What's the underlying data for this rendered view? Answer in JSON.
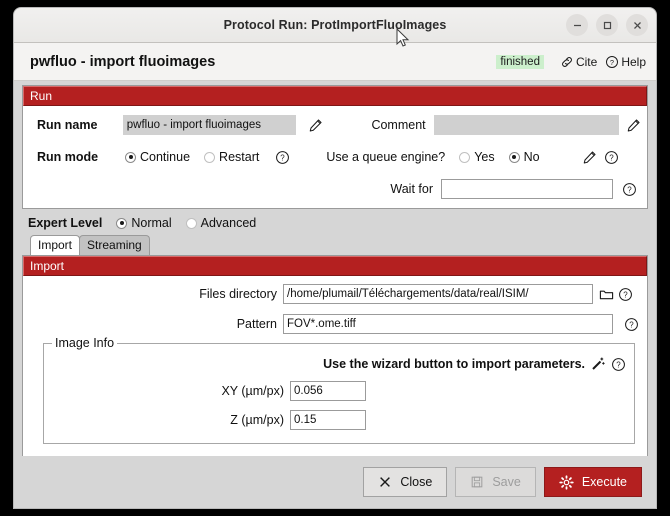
{
  "window": {
    "title": "Protocol Run: ProtImportFluoImages",
    "controls": {
      "minimize": "–",
      "maximize": "□",
      "close": "✕"
    }
  },
  "header": {
    "protocol_name": "pwfluo - import fluoimages",
    "status": "finished",
    "status_color": "#ccefcc",
    "cite_label": "Cite",
    "help_label": "Help"
  },
  "run_section": {
    "title": "Run",
    "run_name_label": "Run name",
    "run_name_value": "pwfluo - import fluoimages",
    "comment_label": "Comment",
    "comment_value": "",
    "run_mode_label": "Run mode",
    "run_mode_options": [
      "Continue",
      "Restart"
    ],
    "run_mode_selected": "Continue",
    "queue_label": "Use a queue engine?",
    "queue_options": [
      "Yes",
      "No"
    ],
    "queue_selected": "No",
    "wait_for_label": "Wait for",
    "wait_for_value": ""
  },
  "expert": {
    "label": "Expert Level",
    "options": [
      "Normal",
      "Advanced"
    ],
    "selected": "Normal"
  },
  "tabs": [
    {
      "label": "Import",
      "active": true
    },
    {
      "label": "Streaming",
      "active": false
    }
  ],
  "import_section": {
    "title": "Import",
    "files_directory_label": "Files directory",
    "files_directory_value": "/home/plumail/Téléchargements/data/real/ISIM/",
    "pattern_label": "Pattern",
    "pattern_value": "FOV*.ome.tiff"
  },
  "image_info": {
    "group_title": "Image Info",
    "wizard_text": "Use the wizard button to import parameters.",
    "xy_label": "XY (µm/px)",
    "xy_value": "0.056",
    "z_label": "Z (µm/px)",
    "z_value": "0.15"
  },
  "footer": {
    "close_label": "Close",
    "save_label": "Save",
    "execute_label": "Execute",
    "execute_color": "#b42020"
  }
}
